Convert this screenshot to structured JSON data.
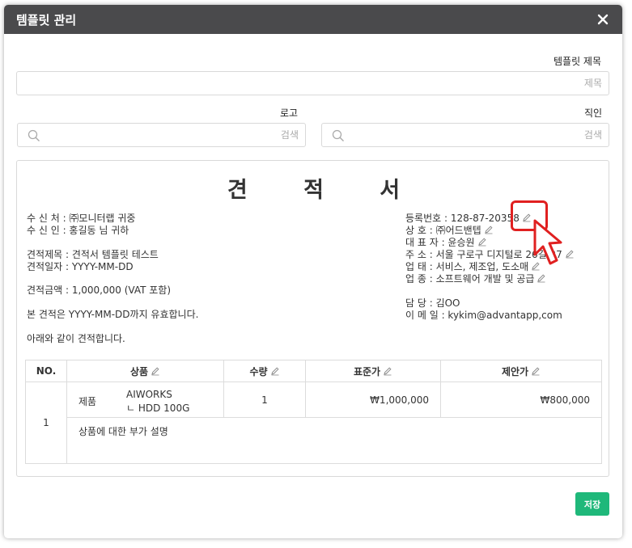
{
  "modal": {
    "title": "템플릿 관리"
  },
  "form": {
    "template_title_label": "템플릿 제목",
    "template_title_placeholder": "제목",
    "logo_label": "로고",
    "logo_placeholder": "검색",
    "seal_label": "직인",
    "seal_placeholder": "검색"
  },
  "document": {
    "title": "견 적 서",
    "left": {
      "recipient": "수 신 처 : ㈜모니터랩 귀중",
      "receiver": "수 신 인 : 홍길동 님 귀하",
      "subject": "견적제목 : 견적서 템플릿 테스트",
      "date": "견적일자 : YYYY-MM-DD",
      "amount": "견적금액 : 1,000,000 (VAT 포함)",
      "validity": "본 견적은 YYYY-MM-DD까지 유효합니다.",
      "closing": "아래와 같이 견적합니다."
    },
    "right": {
      "reg_no": "등록번호 : 128-87-20358",
      "company": "상      호 : ㈜어드밴텝",
      "ceo": "대 표 자 : 윤승원",
      "address": "주      소 : 서울 구로구 디지털로 26길 27",
      "business_type": "업      태 : 서비스, 제조업, 도소매",
      "business_item": "업      종 : 소프트웨어 개발 및 공급",
      "manager": "담      당 : 김OO",
      "email": "이 메 일 : kykim@advantapp,com"
    },
    "table": {
      "headers": {
        "no": "NO.",
        "product": "상품",
        "qty": "수량",
        "std_price": "표준가",
        "offer_price": "제안가"
      },
      "rows": [
        {
          "no": "1",
          "category": "제품",
          "product_name": "AIWORKS",
          "product_sub": "ㄴ HDD 100G",
          "qty": "1",
          "std_price": "₩1,000,000",
          "offer_price": "₩800,000",
          "description": "상품에 대한 부가 설명"
        }
      ]
    }
  },
  "actions": {
    "save_label": "저장"
  },
  "colors": {
    "header_bg": "#4a4a4c",
    "save_bg": "#1fb87a",
    "highlight": "#e02020"
  },
  "icons": [
    "close-icon",
    "search-icon",
    "pencil-icon",
    "cursor-arrow-icon"
  ]
}
